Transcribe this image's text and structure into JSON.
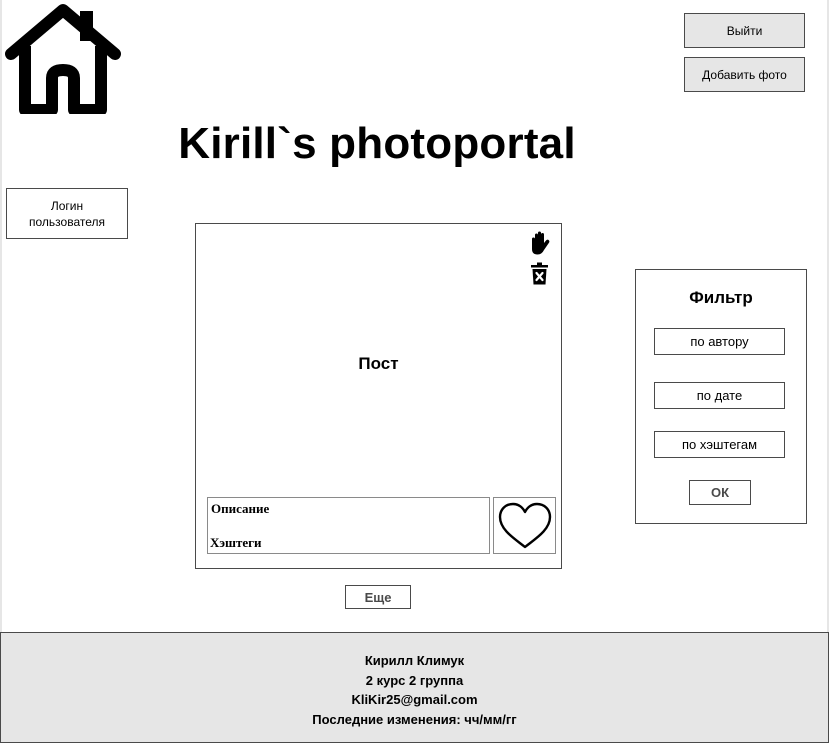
{
  "header": {
    "home_icon": "home-icon",
    "logout_label": "Выйти",
    "add_photo_label": "Добавить фото",
    "title": "Kirill`s photoportal"
  },
  "user": {
    "login_label": "Логин пользователя"
  },
  "post": {
    "title": "Пост",
    "description_label": "Описание",
    "hashtags_label": "Хэштеги",
    "icons": [
      "hand-icon",
      "trash-icon",
      "heart-icon"
    ]
  },
  "more_label": "Еще",
  "filter": {
    "title": "Фильтр",
    "by_author": "по автору",
    "by_date": "по дате",
    "by_hashtags": "по хэштегам",
    "ok_label": "ОК"
  },
  "footer": {
    "name": "Кирилл Климук",
    "course": "2 курс 2 группа",
    "email": "KliKir25@gmail.com",
    "last_modified": "Последние изменения: чч/мм/гг"
  },
  "colors": {
    "panel_gray": "#e6e6e6",
    "border": "#4a4a4a"
  }
}
